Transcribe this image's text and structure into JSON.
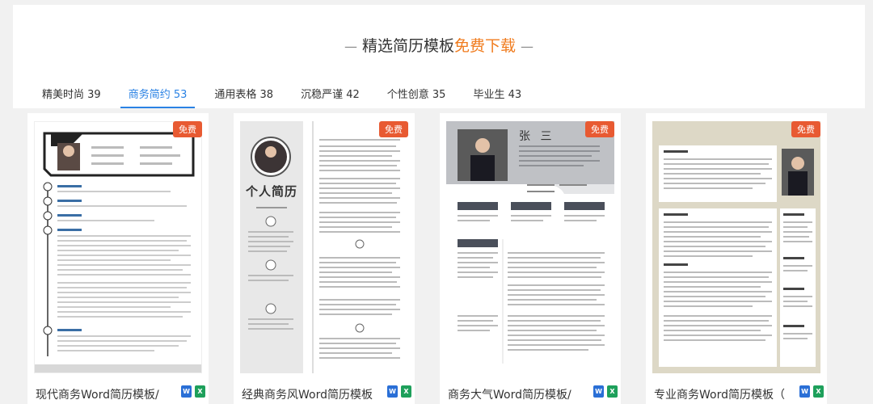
{
  "header": {
    "title_prefix": "精选简历模板",
    "title_accent": "免费下载"
  },
  "tabs": [
    {
      "label": "精美时尚 39",
      "active": false
    },
    {
      "label": "商务简约 53",
      "active": true
    },
    {
      "label": "通用表格 38",
      "active": false
    },
    {
      "label": "沉稳严谨 42",
      "active": false
    },
    {
      "label": "个性创意 35",
      "active": false
    },
    {
      "label": "毕业生 43",
      "active": false
    }
  ],
  "cards": [
    {
      "badge": "免费",
      "title": "现代商务Word简历模板/",
      "icons": [
        "word-icon",
        "excel-icon"
      ]
    },
    {
      "badge": "免费",
      "title": "经典商务风Word简历模板",
      "icons": [
        "word-icon",
        "excel-icon"
      ],
      "thumb_heading": "个人简历"
    },
    {
      "badge": "免费",
      "title": "商务大气Word简历模板/",
      "icons": [
        "word-icon",
        "excel-icon"
      ],
      "thumb_name": "张 三"
    },
    {
      "badge": "免费",
      "title": "专业商务Word简历模板（",
      "icons": [
        "word-icon",
        "excel-icon"
      ]
    }
  ],
  "colors": {
    "accent": "#f07b1d",
    "active_tab": "#2a82e4",
    "badge": "#e85a32"
  }
}
